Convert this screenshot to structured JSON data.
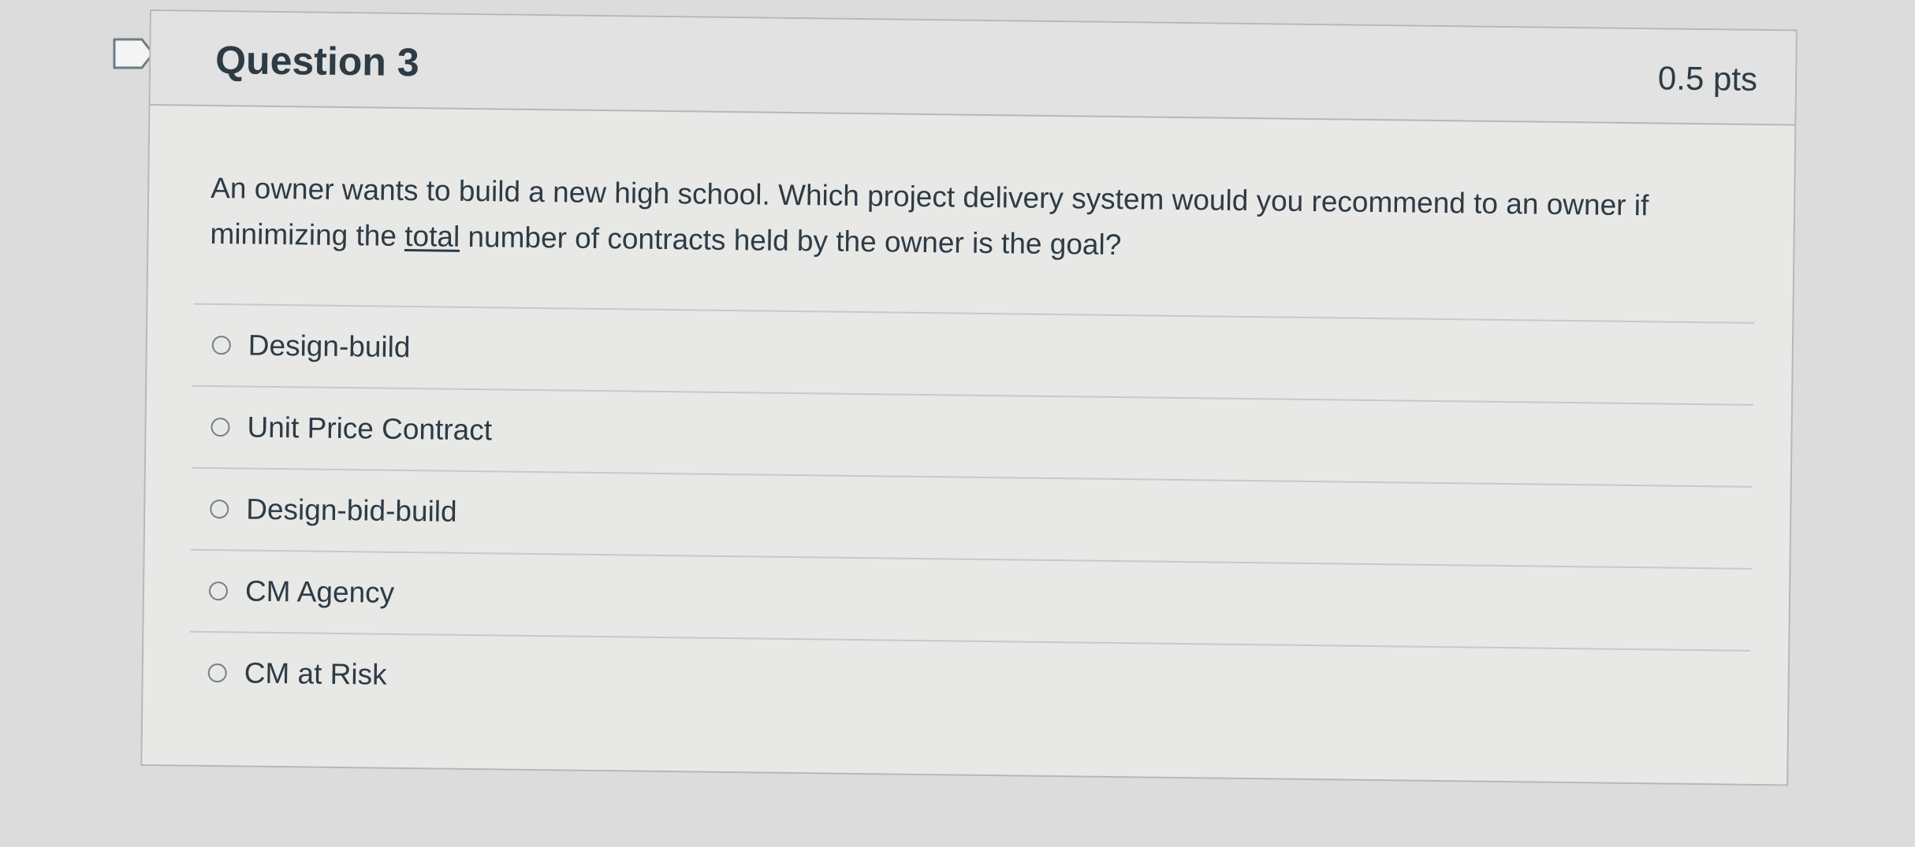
{
  "question": {
    "title": "Question 3",
    "points": "0.5 pts",
    "text_before": "An owner wants to build a new high school. Which project delivery system would you recommend to an owner if minimizing the ",
    "text_underlined": "total",
    "text_after": " number of contracts held by the owner is the goal?",
    "answers": [
      {
        "label": "Design-build",
        "selected": false
      },
      {
        "label": "Unit Price Contract",
        "selected": false
      },
      {
        "label": "Design-bid-build",
        "selected": false
      },
      {
        "label": "CM Agency",
        "selected": false
      },
      {
        "label": "CM at Risk",
        "selected": false
      }
    ]
  },
  "icons": {
    "flag": "flag-question-icon"
  },
  "colors": {
    "text": "#2d3b45",
    "border": "#b5b8ba",
    "radio": "#73818a"
  }
}
